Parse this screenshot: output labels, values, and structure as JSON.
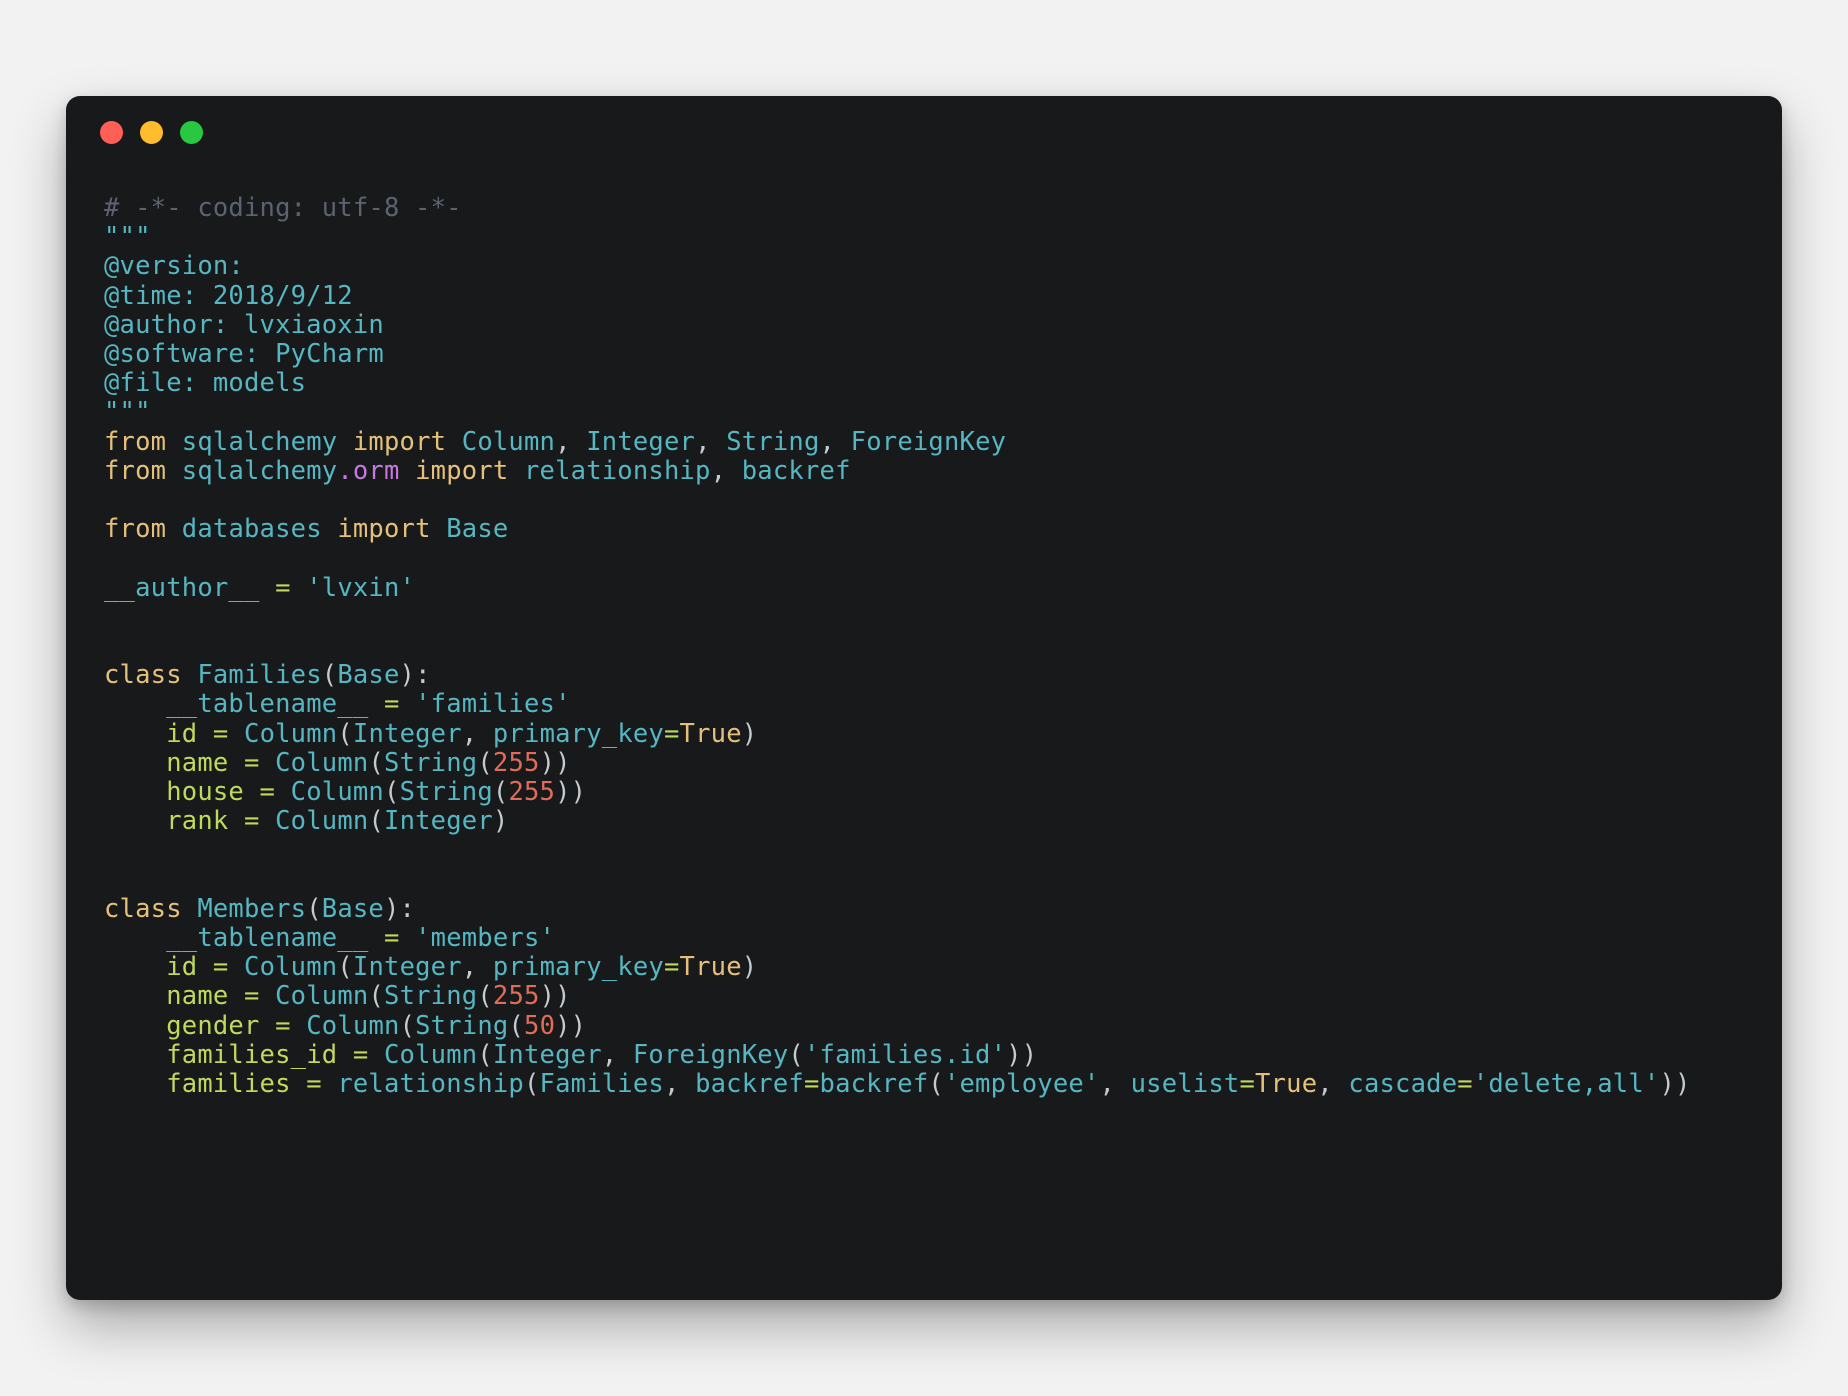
{
  "window": {
    "controls": [
      {
        "name": "close",
        "color": "#ff5f57"
      },
      {
        "name": "minimize",
        "color": "#febc2e"
      },
      {
        "name": "maximize",
        "color": "#28c840"
      }
    ],
    "background": "#17191b",
    "page_background": "#f2f2f2"
  },
  "editor": {
    "language": "python",
    "theme_colors": {
      "comment": "#5c6370",
      "keyword": "#e5c07b",
      "name": "#56b6c2",
      "string": "#56b6c2",
      "attribute": "#c678dd",
      "assign_target": "#bfd95c",
      "operator": "#bfd95c",
      "number": "#e06c5a",
      "punctuation": "#c3cbd0",
      "foreground": "#b9c2c6"
    },
    "lines": [
      "# -*- coding: utf-8 -*-",
      "\"\"\"",
      "@version:",
      "@time: 2018/9/12",
      "@author: lvxiaoxin",
      "@software: PyCharm",
      "@file: models",
      "\"\"\"",
      "from sqlalchemy import Column, Integer, String, ForeignKey",
      "from sqlalchemy.orm import relationship, backref",
      "",
      "from databases import Base",
      "",
      "__author__ = 'lvxin'",
      "",
      "",
      "class Families(Base):",
      "    __tablename__ = 'families'",
      "    id = Column(Integer, primary_key=True)",
      "    name = Column(String(255))",
      "    house = Column(String(255))",
      "    rank = Column(Integer)",
      "",
      "",
      "class Members(Base):",
      "    __tablename__ = 'members'",
      "    id = Column(Integer, primary_key=True)",
      "    name = Column(String(255))",
      "    gender = Column(String(50))",
      "    families_id = Column(Integer, ForeignKey('families.id'))",
      "    families = relationship(Families, backref=backref('employee', uselist=True, cascade='delete,all'))"
    ],
    "tokens": {
      "comment_line": "# -*- coding: utf-8 -*-",
      "docstring_delim": "\"\"\"",
      "meta_version": "@version:",
      "meta_time": "@time: 2018/9/12",
      "meta_author": "@author: lvxiaoxin",
      "meta_software": "@software: PyCharm",
      "meta_file": "@file: models",
      "kw_from": "from",
      "kw_import": "import",
      "kw_class": "class",
      "mod_sqlalchemy": "sqlalchemy",
      "mod_orm": ".orm",
      "mod_databases": "databases",
      "imp_column": "Column",
      "imp_integer": "Integer",
      "imp_string": "String",
      "imp_foreignkey": "ForeignKey",
      "imp_relationship": "relationship",
      "imp_backref": "backref",
      "imp_base": "Base",
      "var_author": "__author__",
      "str_lvxin": "'lvxin'",
      "cls_families": "Families",
      "cls_members": "Members",
      "var_tablename": "__tablename__",
      "str_families": "'families'",
      "str_members": "'members'",
      "var_id": "id",
      "var_name": "name",
      "var_house": "house",
      "var_rank": "rank",
      "var_gender": "gender",
      "var_families_id": "families_id",
      "var_families": "families",
      "kwarg_primary_key": "primary_key",
      "kwarg_uselist": "uselist",
      "kwarg_cascade": "cascade",
      "kwarg_backref": "backref",
      "val_true": "True",
      "num_255": "255",
      "num_50": "50",
      "str_families_id": "'families.id'",
      "str_employee": "'employee'",
      "str_delete_all": "'delete,all'",
      "op_assign": "=",
      "op_eq": "="
    }
  }
}
